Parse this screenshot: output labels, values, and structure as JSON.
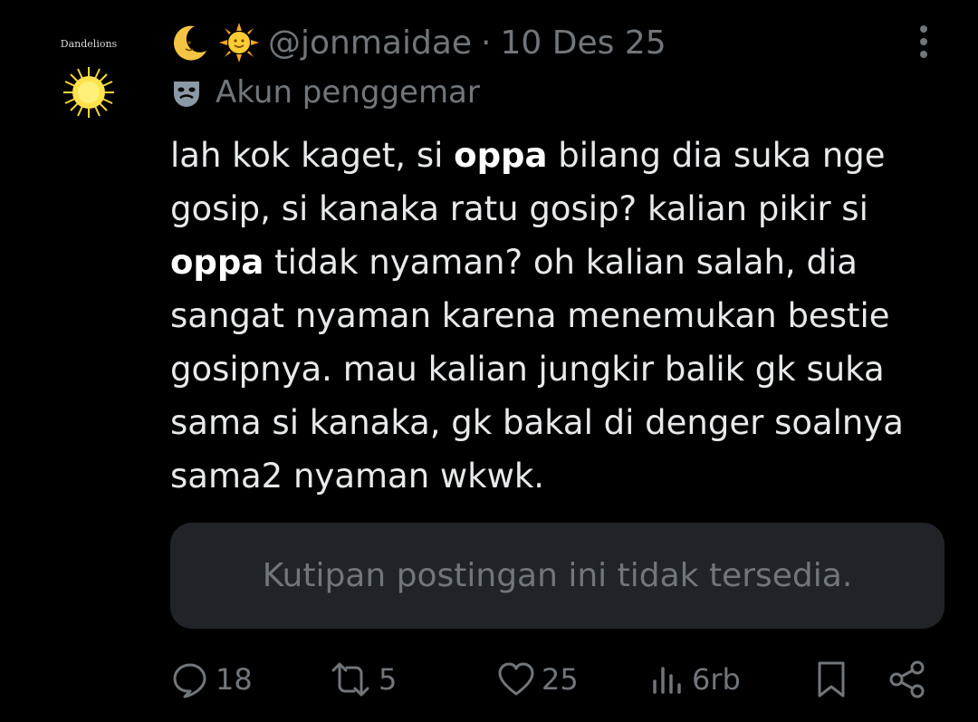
{
  "avatar": {
    "caption": "Dandelions"
  },
  "header": {
    "emojis": [
      "crescent-moon-icon",
      "sun-with-face-icon"
    ],
    "handle": "@jonmaidae",
    "separator": "·",
    "date": "10 Des 25"
  },
  "label": {
    "icon": "theater-mask-icon",
    "text": "Akun penggemar"
  },
  "tweet": {
    "segments": [
      {
        "text": "lah kok kaget, si ",
        "bold": false
      },
      {
        "text": "oppa",
        "bold": true
      },
      {
        "text": " bilang dia suka nge gosip, si kanaka ratu gosip? kalian pikir si ",
        "bold": false
      },
      {
        "text": "oppa",
        "bold": true
      },
      {
        "text": " tidak nyaman? oh kalian salah, dia sangat nyaman karena menemukan bestie gosipnya. mau kalian jungkir balik gk suka sama si kanaka, gk bakal di denger soalnya sama2 nyaman wkwk.",
        "bold": false
      }
    ]
  },
  "quote": {
    "text": "Kutipan postingan ini tidak tersedia."
  },
  "actions": {
    "replies": "18",
    "reposts": "5",
    "likes": "25",
    "views": "6rb"
  },
  "colors": {
    "background": "#000000",
    "text": "#e7e9ea",
    "muted": "#71767b",
    "quote_bg": "#202327"
  }
}
